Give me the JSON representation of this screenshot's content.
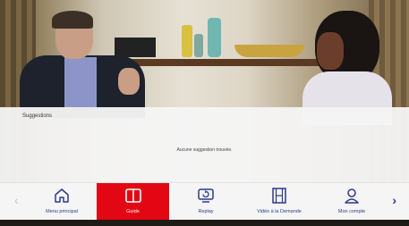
{
  "suggestions": {
    "title": "Suggestions",
    "empty_message": "Aucune suggestion trouvée."
  },
  "nav": {
    "prev_icon": "chevron-left-icon",
    "next_icon": "chevron-right-icon",
    "items": [
      {
        "label": "Menu principal",
        "icon": "home-icon",
        "active": false
      },
      {
        "label": "Guide",
        "icon": "book-icon",
        "active": true
      },
      {
        "label": "Replay",
        "icon": "replay-icon",
        "active": false
      },
      {
        "label": "Vidéo à la Demande",
        "icon": "film-icon",
        "active": false
      },
      {
        "label": "Mon compte",
        "icon": "user-icon",
        "active": false
      }
    ]
  },
  "colors": {
    "accent": "#e30613",
    "nav_text": "#2b3a8f",
    "overlay_bg": "#f5f5f5"
  }
}
